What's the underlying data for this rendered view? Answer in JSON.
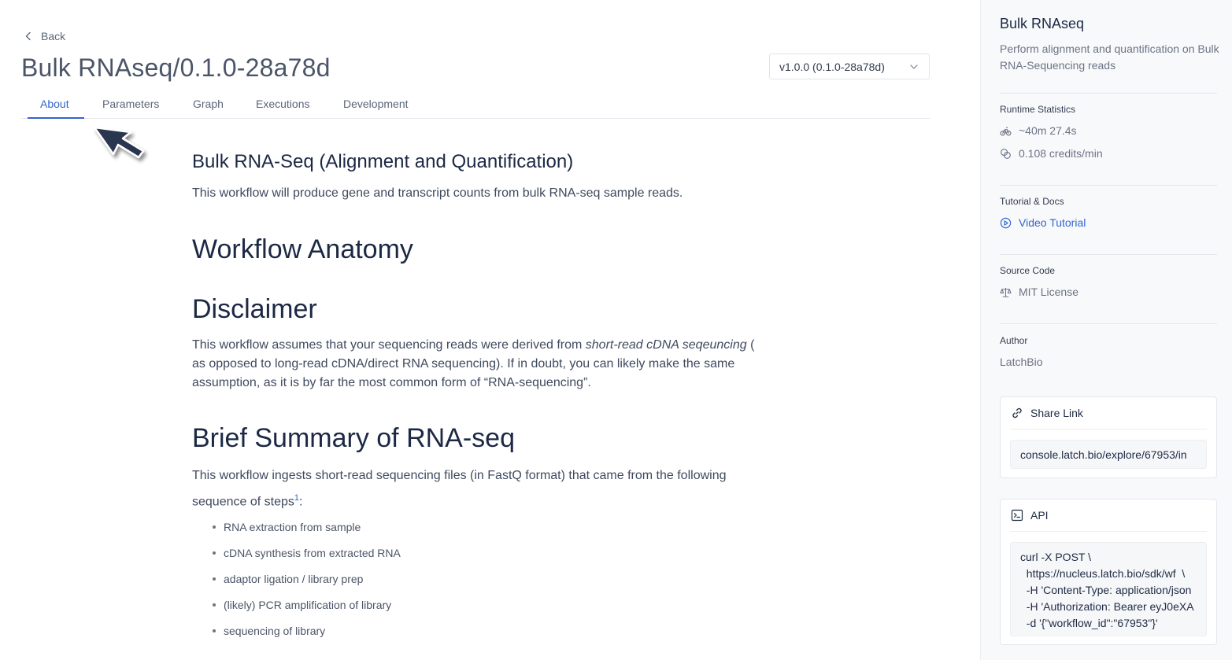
{
  "header": {
    "back_label": "Back",
    "title": "Bulk RNAseq/0.1.0-28a78d",
    "version_selected": "v1.0.0 (0.1.0-28a78d)"
  },
  "tabs": [
    {
      "label": "About",
      "active": true
    },
    {
      "label": "Parameters",
      "active": false
    },
    {
      "label": "Graph",
      "active": false
    },
    {
      "label": "Executions",
      "active": false
    },
    {
      "label": "Development",
      "active": false
    }
  ],
  "content": {
    "heading": "Bulk RNA-Seq (Alignment and Quantification)",
    "intro": "This workflow will produce gene and transcript counts from bulk RNA-seq sample reads.",
    "anatomy_heading": "Workflow Anatomy",
    "disclaimer_heading": "Disclaimer",
    "disclaimer_before": "This workflow assumes that your sequencing reads were derived from ",
    "disclaimer_emphasis": "short-read cDNA seqeuncing",
    "disclaimer_after": " ( as opposed to long-read cDNA/direct RNA sequencing). If in doubt, you can likely make the same assumption, as it is by far the most common form of “RNA-sequencing”.",
    "summary_heading": "Brief Summary of RNA-seq",
    "summary_text": "This workflow ingests short-read sequencing files (in FastQ format) that came from the following sequence of steps",
    "summary_footnote": "1",
    "summary_suffix": ":",
    "steps": [
      "RNA extraction from sample",
      "cDNA synthesis from extracted RNA",
      "adaptor ligation / library prep",
      "(likely) PCR amplification of library",
      "sequencing of library"
    ]
  },
  "sidebar": {
    "title": "Bulk RNAseq",
    "description": "Perform alignment and quantification on Bulk RNA-Sequencing reads",
    "runtime_label": "Runtime Statistics",
    "runtime_duration": "~40m 27.4s",
    "runtime_credits": "0.108 credits/min",
    "docs_label": "Tutorial & Docs",
    "docs_link": "Video Tutorial",
    "source_label": "Source Code",
    "license": "MIT License",
    "author_label": "Author",
    "author": "LatchBio",
    "share_title": "Share Link",
    "share_url": "console.latch.bio/explore/67953/in",
    "api_title": "API",
    "api_lines": [
      "curl -X POST \\",
      "  https://nucleus.latch.bio/sdk/wf  \\",
      "  -H 'Content-Type: application/json",
      "  -H 'Authorization: Bearer eyJ0eXA",
      "  -d '{\"workflow_id\":\"67953\"}'"
    ]
  },
  "colors": {
    "accent": "#3366cc",
    "heading": "#1c2844",
    "body_text": "#3f4a5e",
    "sidebar_bg": "#f8f9fb"
  }
}
